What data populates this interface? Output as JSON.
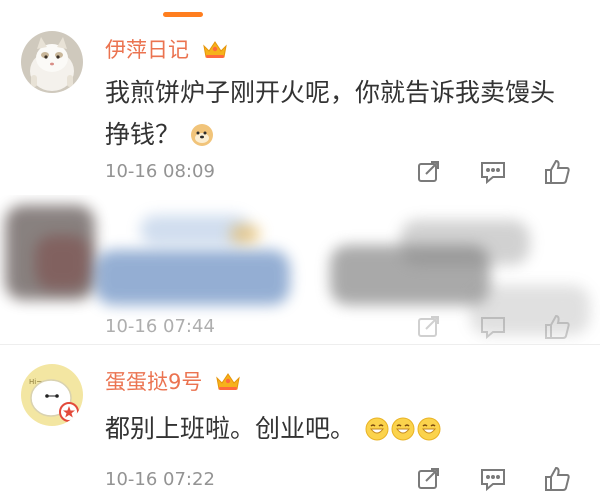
{
  "comments": [
    {
      "username": "伊萍日记",
      "text": "我煎饼炉子刚开火呢，你就告诉我卖馒头挣钱？",
      "emoji": "doge-emoji",
      "time": "10-16 08:09",
      "vip": true
    },
    {
      "username": "",
      "text": "",
      "time": "10-16 07:44",
      "obscured": true
    },
    {
      "username": "蛋蛋挞9号",
      "text": "都别上班啦。创业吧。",
      "emoji": "grin-emoji",
      "emoji_count": 3,
      "time": "10-16 07:22",
      "vip": true
    }
  ],
  "colors": {
    "username": "#eb7350",
    "text": "#333333",
    "meta": "#939393",
    "accent": "#ff7e1f",
    "icon": "#7a7a7a"
  },
  "icons": {
    "forward": "share-icon",
    "comment": "comment-icon",
    "like": "thumbs-up-icon",
    "vip": "crown-icon"
  }
}
